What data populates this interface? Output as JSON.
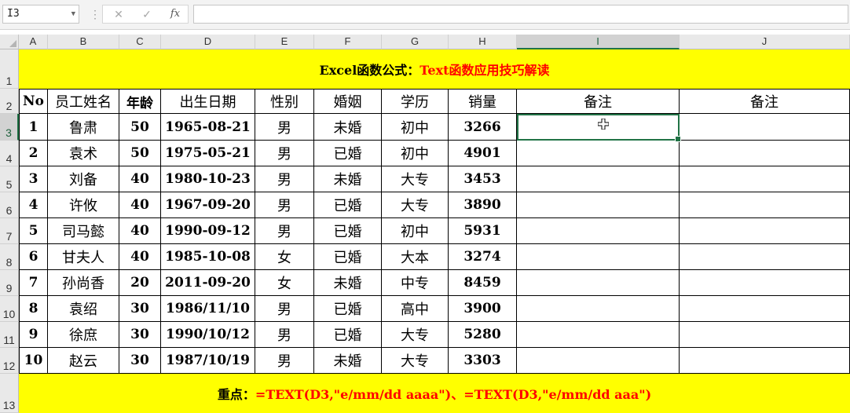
{
  "formula_bar": {
    "name_box": "I3",
    "cancel_icon": "✕",
    "enter_icon": "✓",
    "fx_label": "fx",
    "formula": ""
  },
  "columns": [
    "A",
    "B",
    "C",
    "D",
    "E",
    "F",
    "G",
    "H",
    "I",
    "J"
  ],
  "selected_column": "I",
  "rows": [
    "1",
    "2",
    "3",
    "4",
    "5",
    "6",
    "7",
    "8",
    "9",
    "10",
    "11",
    "12",
    "13"
  ],
  "selected_row": "3",
  "title": {
    "black_part": "Excel函数公式：",
    "red_part": "Text函数应用技巧解读"
  },
  "table": {
    "headers": [
      "No",
      "员工姓名",
      "年龄",
      "出生日期",
      "性别",
      "婚姻",
      "学历",
      "销量",
      "备注",
      "备注"
    ],
    "rows": [
      [
        "1",
        "鲁肃",
        "50",
        "1965-08-21",
        "男",
        "未婚",
        "初中",
        "3266",
        "",
        ""
      ],
      [
        "2",
        "袁术",
        "50",
        "1975-05-21",
        "男",
        "已婚",
        "初中",
        "4901",
        "",
        ""
      ],
      [
        "3",
        "刘备",
        "40",
        "1980-10-23",
        "男",
        "未婚",
        "大专",
        "3453",
        "",
        ""
      ],
      [
        "4",
        "许攸",
        "40",
        "1967-09-20",
        "男",
        "已婚",
        "大专",
        "3890",
        "",
        ""
      ],
      [
        "5",
        "司马懿",
        "40",
        "1990-09-12",
        "男",
        "已婚",
        "初中",
        "5931",
        "",
        ""
      ],
      [
        "6",
        "甘夫人",
        "40",
        "1985-10-08",
        "女",
        "已婚",
        "大本",
        "3274",
        "",
        ""
      ],
      [
        "7",
        "孙尚香",
        "20",
        "2011-09-20",
        "女",
        "未婚",
        "中专",
        "8459",
        "",
        ""
      ],
      [
        "8",
        "袁绍",
        "30",
        "1986/11/10",
        "男",
        "已婚",
        "高中",
        "3900",
        "",
        ""
      ],
      [
        "9",
        "徐庶",
        "30",
        "1990/10/12",
        "男",
        "已婚",
        "大专",
        "5280",
        "",
        ""
      ],
      [
        "10",
        "赵云",
        "30",
        "1987/10/19",
        "男",
        "未婚",
        "大专",
        "3303",
        "",
        ""
      ]
    ]
  },
  "footer": {
    "black_part": "重点：",
    "red_part": "=TEXT(D3,\"e/mm/dd aaaa\")、=TEXT(D3,\"e/mm/dd aaa\")"
  },
  "colors": {
    "band": "#ffff00",
    "accent_red": "#ff0000",
    "selection": "#217346"
  }
}
